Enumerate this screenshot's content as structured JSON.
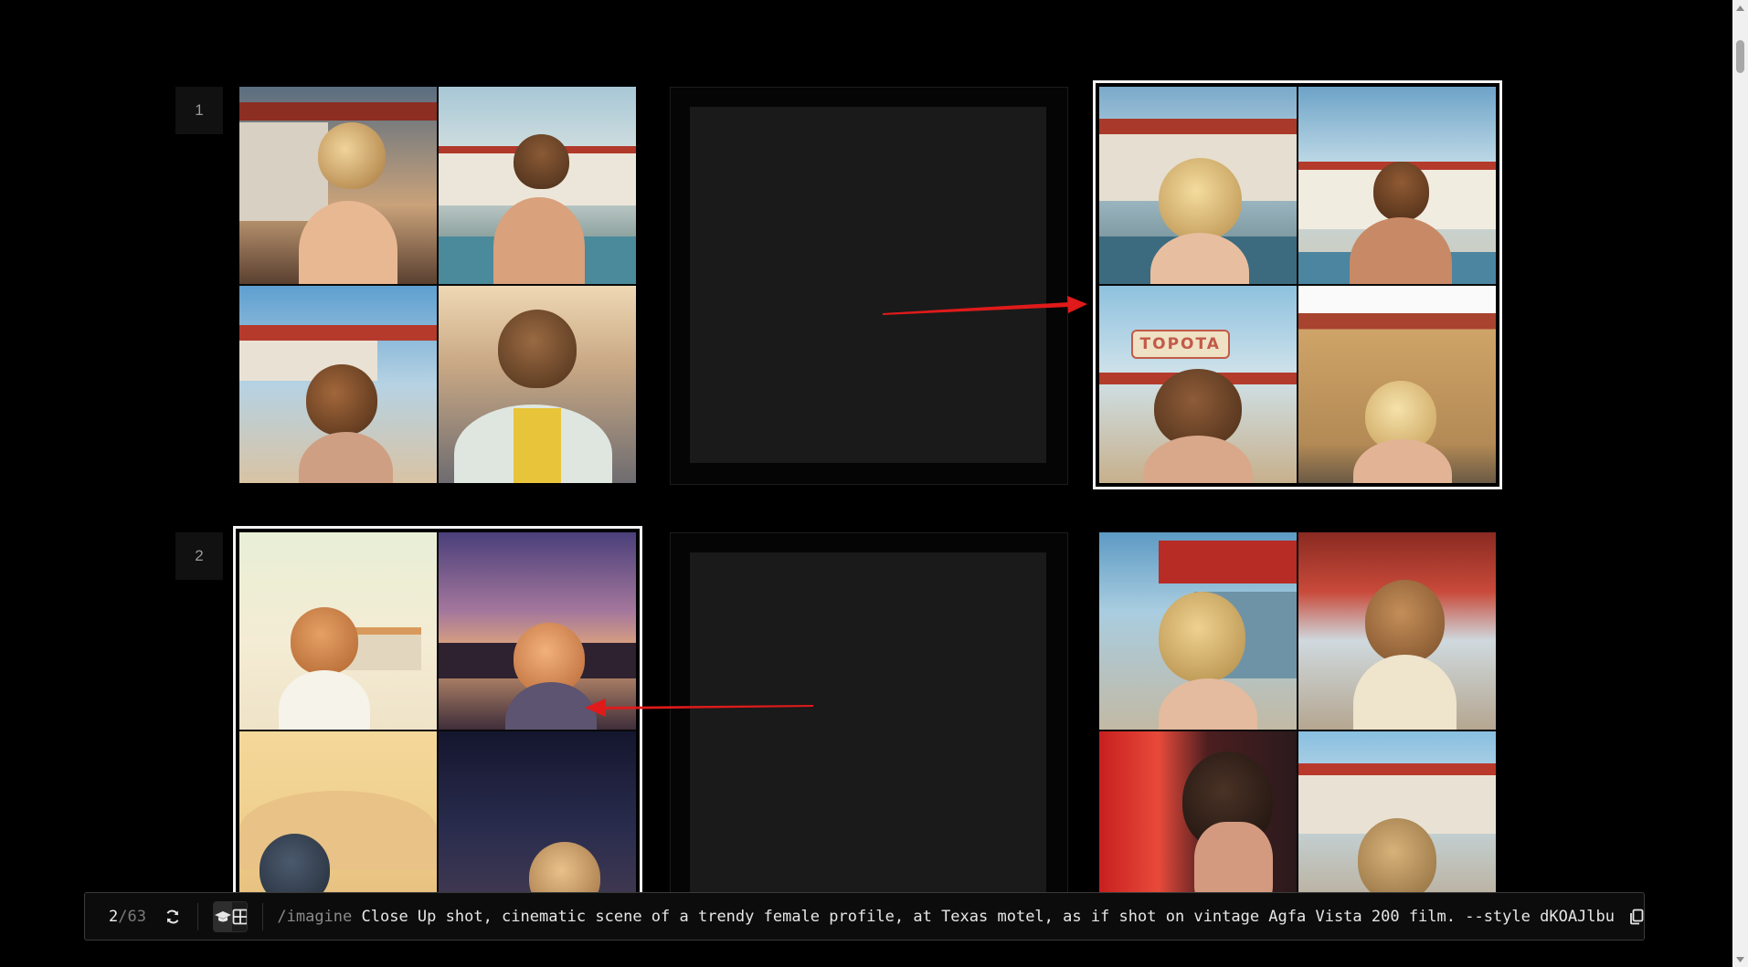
{
  "rows": [
    {
      "number": "1"
    },
    {
      "number": "2"
    }
  ],
  "tiles": {
    "sign_topota": "TOPOTA"
  },
  "prompt_bar": {
    "current": "2",
    "separator": "/",
    "total": "63",
    "command": "/imagine",
    "text": "Close Up shot, cinematic scene of a trendy female profile, at Texas motel, as if shot on vintage Agfa Vista 200 film. --style dKOAJlbu"
  },
  "icons": {
    "refresh": "refresh-icon",
    "grad_cap": "graduation-cap-icon",
    "grid": "grid-icon",
    "copy": "copy-icon",
    "scroll_up": "scroll-up-arrow-icon",
    "scroll_down": "scroll-down-arrow-icon"
  },
  "colors": {
    "background": "#000000",
    "selection_border": "#f2f2f2",
    "arrow": "#e01a1a",
    "placeholder": "#1a1a1a"
  }
}
